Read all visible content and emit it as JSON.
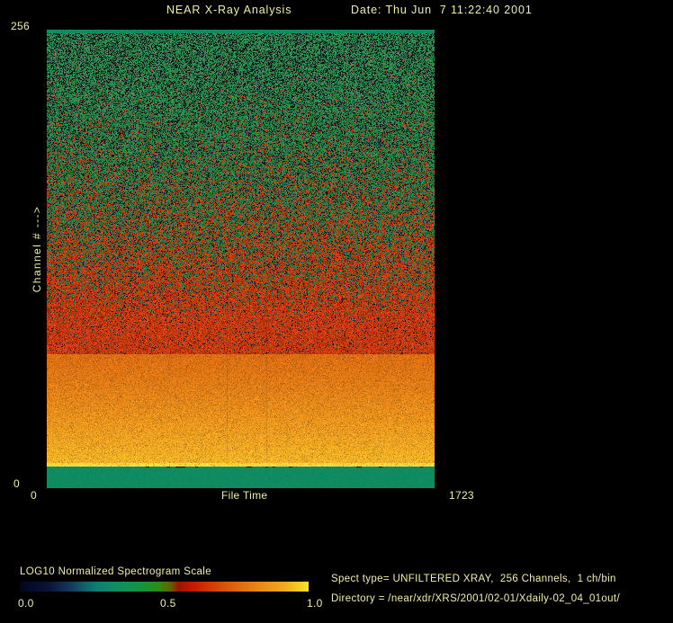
{
  "window": {
    "background": "#000000",
    "text_color": "#f2efa2"
  },
  "header": {
    "title": "NEAR X-Ray Analysis",
    "date_label": "Date: Thu Jun  7 11:22:40 2001"
  },
  "chart_data": {
    "type": "heatmap",
    "title": "NEAR X-Ray Analysis",
    "xlabel": "File Time",
    "ylabel": "Channel # --->",
    "x_range": [
      0,
      1723
    ],
    "y_range": [
      0,
      256
    ],
    "x_tick_labels": [
      "0",
      "1723"
    ],
    "y_tick_labels": [
      "0",
      "256"
    ],
    "grid": false,
    "description": "Normalized X-ray spectrogram, channel number vs file time; intensity mapped through LOG10 normalized color scale",
    "bands": [
      {
        "name": "top-teal-strip",
        "channel_from": 254,
        "channel_to": 256,
        "style": "solid",
        "color": "#0E8B60"
      },
      {
        "name": "green-to-red-speckle",
        "channel_from": 75,
        "channel_to": 254,
        "style": "speckle-mix",
        "top_color": "#2E9050",
        "bottom_color": "#C83C10",
        "speckle_dark": "#0A0E16"
      },
      {
        "name": "orange-band",
        "channel_from": 14,
        "channel_to": 75,
        "style": "noisy-gradient",
        "top_color": "#DB6E12",
        "bottom_color": "#F4B426"
      },
      {
        "name": "bright-yellow-edge",
        "channel_from": 12,
        "channel_to": 14,
        "style": "noisy-gradient",
        "top_color": "#FFD435",
        "bottom_color": "#FFDC48"
      },
      {
        "name": "bottom-teal-band",
        "channel_from": 0,
        "channel_to": 12,
        "style": "solid",
        "color": "#0E8B60"
      }
    ],
    "artifact_columns": [
      0.464,
      0.566
    ],
    "colorbar": {
      "stops": [
        {
          "pos": 0.0,
          "color": "#03051c"
        },
        {
          "pos": 0.1,
          "color": "#0a1338"
        },
        {
          "pos": 0.18,
          "color": "#143c5e"
        },
        {
          "pos": 0.26,
          "color": "#107a74"
        },
        {
          "pos": 0.33,
          "color": "#0e8f62"
        },
        {
          "pos": 0.42,
          "color": "#149440"
        },
        {
          "pos": 0.48,
          "color": "#2f8c12"
        },
        {
          "pos": 0.52,
          "color": "#5e6402"
        },
        {
          "pos": 0.55,
          "color": "#9c1600"
        },
        {
          "pos": 0.6,
          "color": "#c81800"
        },
        {
          "pos": 0.7,
          "color": "#d84e08"
        },
        {
          "pos": 0.82,
          "color": "#e88514"
        },
        {
          "pos": 0.92,
          "color": "#f1ab1c"
        },
        {
          "pos": 1.0,
          "color": "#f8e12c"
        }
      ]
    }
  },
  "legend": {
    "label": "LOG10 Normalized Spectrogram Scale",
    "ticks": [
      "0.0",
      "0.5",
      "1.0"
    ]
  },
  "info": {
    "spect_type": "Spect type= UNFILTERED XRAY,  256 Channels,  1 ch/bin",
    "directory": "Directory = /near/xdr/XRS/2001/02-01/Xdaily-02_04_01out/"
  }
}
